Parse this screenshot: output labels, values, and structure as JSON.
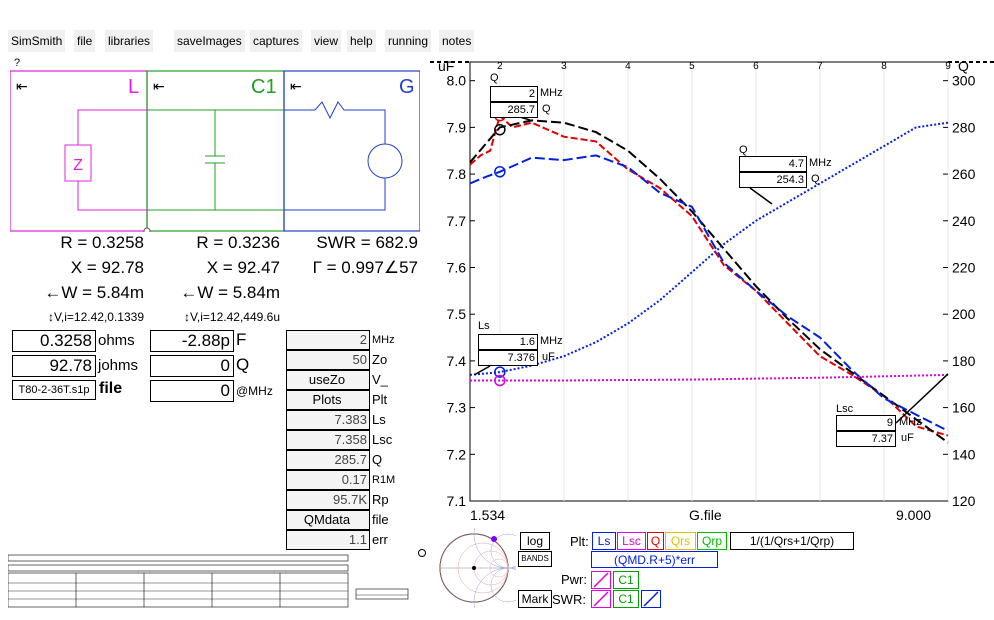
{
  "menu": [
    "SimSmith",
    "file",
    "libraries",
    "saveImages",
    "captures",
    "view",
    "help",
    "running",
    "notes"
  ],
  "help_mark": "?",
  "circuit": {
    "blocks": [
      {
        "name": "L",
        "color": "#e020e0"
      },
      {
        "name": "C1",
        "color": "#20a020"
      },
      {
        "name": "G",
        "color": "#2040d0"
      }
    ],
    "arrow": "⇤",
    "col1": {
      "r": "R = 0.3258",
      "x": "X = 92.78",
      "w": "←W = 5.84m",
      "vi": "↕V,i=12.42,0.1339"
    },
    "col2": {
      "r": "R = 0.3236",
      "x": "X = 92.47",
      "w": "←W = 5.84m",
      "vi": "↕V,i=12.42,449.6u"
    },
    "col3": {
      "swr": "SWR = 682.9",
      "gamma": "Γ = 0.997∠57"
    }
  },
  "load": {
    "ohms_val": "0.3258",
    "ohms_lbl": "ohms",
    "johms_val": "92.78",
    "johms_lbl": "johms",
    "file_val": "T80-2-36T.s1p",
    "file_lbl": "file"
  },
  "cap": {
    "f_val": "-2.88p",
    "f_lbl": "F",
    "q_val": "0",
    "q_lbl": "Q",
    "mhz_val": "0",
    "mhz_lbl": "@MHz"
  },
  "params": [
    {
      "val": "2",
      "lbl": "MHz"
    },
    {
      "val": "50",
      "lbl": "Zo"
    },
    {
      "val": "useZo",
      "lbl": "V_"
    },
    {
      "val": "Plots",
      "lbl": "Plt"
    },
    {
      "val": "7.383",
      "lbl": "Ls"
    },
    {
      "val": "7.358",
      "lbl": "Lsc"
    },
    {
      "val": "285.7",
      "lbl": "Q"
    },
    {
      "val": "0.17",
      "lbl": "R1M"
    },
    {
      "val": "95.7K",
      "lbl": "Rp"
    },
    {
      "val": "QMdata",
      "lbl": "file"
    },
    {
      "val": "1.1",
      "lbl": "err"
    }
  ],
  "plot": {
    "left_unit": "uF",
    "right_unit": "Q",
    "x_start": "1.534",
    "x_mid": "G.file",
    "x_end": "9.000",
    "tips": {
      "q1": {
        "title": "Q",
        "mhz": "2",
        "mhz_lbl": "MHz",
        "q": "285.7",
        "q_lbl": "Q"
      },
      "q2": {
        "title": "Q",
        "mhz": "4.7",
        "mhz_lbl": "MHz",
        "q": "254.3",
        "q_lbl": "Q"
      },
      "ls": {
        "title": "Ls",
        "mhz": "1.6",
        "mhz_lbl": "MHz",
        "uf": "7.376",
        "uf_lbl": "uF"
      },
      "lsc": {
        "title": "Lsc",
        "mhz": "9",
        "mhz_lbl": "MHz",
        "uf": "7.37",
        "uf_lbl": "uF"
      }
    }
  },
  "chart_data": {
    "type": "line",
    "xlabel": "G.file",
    "xlim": [
      1.534,
      9.0
    ],
    "x_ticks": [
      "2",
      "3",
      "4",
      "5",
      "6",
      "7",
      "8",
      "9"
    ],
    "y_left": {
      "unit": "uF",
      "ticks": [
        "8.0",
        "7.9",
        "7.8",
        "7.7",
        "7.6",
        "7.5",
        "7.4",
        "7.3",
        "7.2",
        "7.1"
      ],
      "ylim": [
        7.1,
        8.04
      ]
    },
    "y_right": {
      "unit": "Q",
      "ticks": [
        "300",
        "280",
        "260",
        "240",
        "220",
        "200",
        "180",
        "160",
        "140",
        "120"
      ],
      "ylim": [
        120,
        308
      ]
    },
    "series": [
      {
        "color": "#e00000",
        "axis": "right",
        "x": [
          1.534,
          1.7,
          1.85,
          2.0,
          2.2,
          2.5,
          3.0,
          3.5,
          4.0,
          4.5,
          5.0,
          5.5,
          6.0,
          6.5,
          7.0,
          7.5,
          8.0,
          8.5,
          9.0
        ],
        "values": [
          264,
          268,
          270,
          285,
          280,
          282,
          276,
          274,
          262,
          254,
          242,
          221,
          210,
          196,
          182,
          174,
          165,
          152,
          148
        ]
      },
      {
        "color": "#000000",
        "axis": "right",
        "x": [
          1.534,
          2.0,
          2.5,
          3.0,
          3.5,
          4.0,
          4.5,
          5.0,
          5.5,
          6.0,
          6.5,
          7.0,
          7.5,
          8.0,
          8.5,
          9.0
        ],
        "values": [
          265,
          280,
          283,
          282,
          278,
          270,
          258,
          244,
          228,
          212,
          198,
          185,
          175,
          165,
          155,
          145
        ]
      },
      {
        "color": "#0020e0",
        "axis": "right",
        "x": [
          1.534,
          1.8,
          2.0,
          2.5,
          3.0,
          3.5,
          4.0,
          4.5,
          5.0,
          5.5,
          6.0,
          6.5,
          7.0,
          7.5,
          8.0,
          8.5,
          9.0
        ],
        "values": [
          256,
          259,
          261,
          267,
          266,
          268,
          263,
          252,
          246,
          222,
          210,
          199,
          190,
          176,
          164,
          157,
          150
        ]
      },
      {
        "color": "#0020e0",
        "axis": "left",
        "x": [
          1.534,
          2.0,
          2.5,
          3.0,
          3.5,
          4.0,
          4.5,
          5.0,
          5.5,
          6.0,
          6.5,
          7.0,
          7.5,
          8.0,
          8.5,
          9.0
        ],
        "values": [
          7.37,
          7.376,
          7.39,
          7.41,
          7.44,
          7.48,
          7.53,
          7.59,
          7.65,
          7.7,
          7.74,
          7.78,
          7.82,
          7.86,
          7.9,
          7.91
        ]
      },
      {
        "color": "#e000e0",
        "axis": "left",
        "x": [
          1.534,
          2.0,
          3.0,
          4.0,
          5.0,
          6.0,
          7.0,
          8.0,
          9.0
        ],
        "values": [
          7.358,
          7.358,
          7.358,
          7.359,
          7.36,
          7.362,
          7.364,
          7.367,
          7.37
        ]
      }
    ]
  },
  "controls": {
    "log": "log",
    "bands": "BANDS",
    "mark": "Mark",
    "plt_lbl": "Plt:",
    "plt_items": [
      {
        "label": "Ls",
        "color": "#0020e0"
      },
      {
        "label": "Lsc",
        "color": "#e000e0"
      },
      {
        "label": "Q",
        "color": "#e00000"
      },
      {
        "label": "Qrs",
        "color": "#e0c000"
      },
      {
        "label": "Qrp",
        "color": "#00c000"
      }
    ],
    "formula1": "1/(1/Qrs+1/Qrp)",
    "formula2": "(QMD.R+5)*err",
    "pwr_lbl": "Pwr:",
    "swr_lbl": "SWR:",
    "c1": "C1"
  }
}
